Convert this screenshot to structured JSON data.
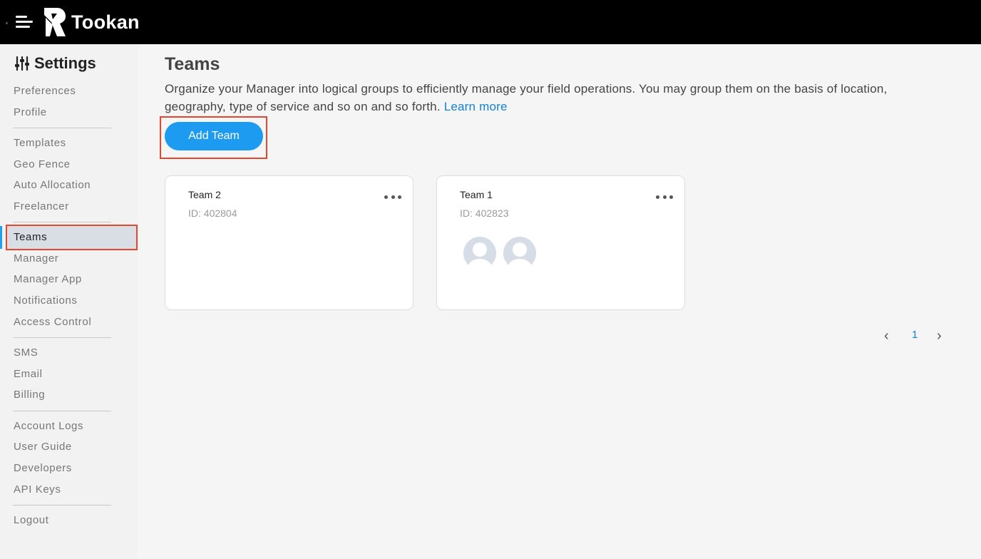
{
  "header": {
    "brand": "Tookan"
  },
  "sidebar": {
    "title": "Settings",
    "items": [
      {
        "label": "Preferences"
      },
      {
        "label": "Profile"
      },
      {
        "label": "Templates"
      },
      {
        "label": "Geo Fence"
      },
      {
        "label": "Auto Allocation"
      },
      {
        "label": "Freelancer"
      },
      {
        "label": "Teams"
      },
      {
        "label": "Manager"
      },
      {
        "label": "Manager App"
      },
      {
        "label": "Notifications"
      },
      {
        "label": "Access Control"
      },
      {
        "label": "SMS"
      },
      {
        "label": "Email"
      },
      {
        "label": "Billing"
      },
      {
        "label": "Account Logs"
      },
      {
        "label": "User Guide"
      },
      {
        "label": "Developers"
      },
      {
        "label": "API Keys"
      },
      {
        "label": "Logout"
      }
    ],
    "active": "Teams"
  },
  "main": {
    "title": "Teams",
    "description": "Organize your Manager into logical groups to efficiently manage your field operations. You may group them on the basis of location, geography, type of service and so on and so forth.",
    "learn_more": "Learn more",
    "add_button": "Add Team",
    "teams": [
      {
        "name": "Team 2",
        "id": "ID: 402804",
        "members": 0
      },
      {
        "name": "Team 1",
        "id": "ID: 402823",
        "members": 2
      }
    ],
    "pagination": {
      "current": "1"
    }
  },
  "colors": {
    "accent": "#1c9bf0",
    "highlight": "#e5462e",
    "link": "#1182d8"
  }
}
